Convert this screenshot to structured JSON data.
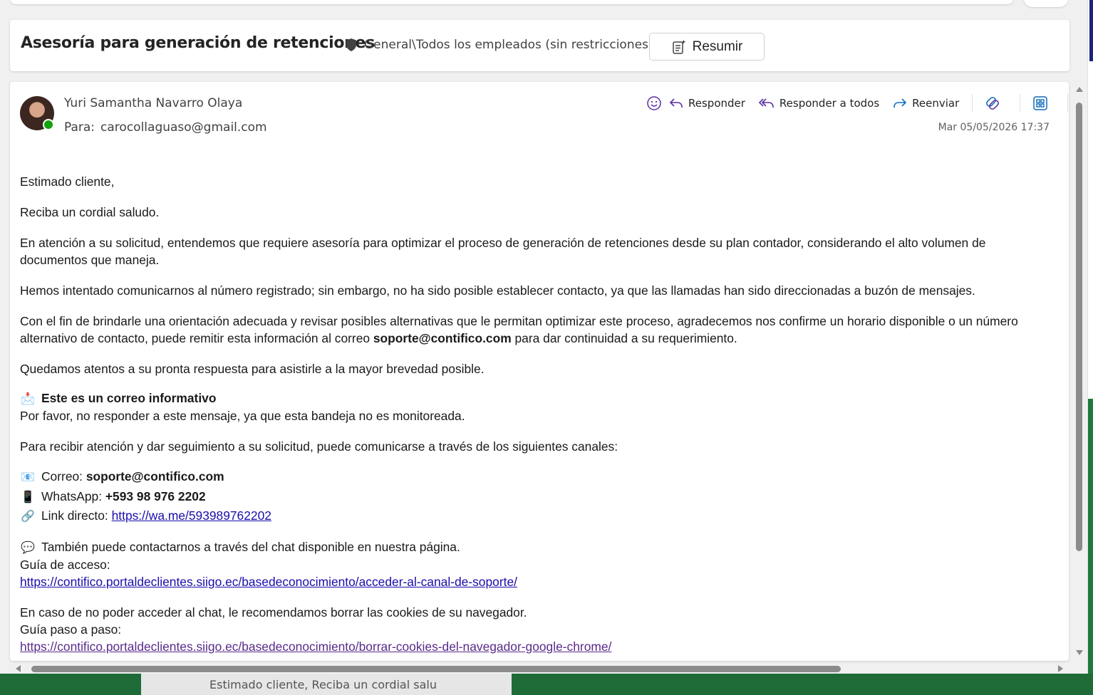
{
  "subject": {
    "title": "Asesoría para generación de retenciones",
    "sensitivity": "General\\Todos los empleados (sin restricciones)",
    "summarize_label": "Resumir"
  },
  "message": {
    "sender": "Yuri Samantha Navarro Olaya",
    "to_label": "Para:",
    "to": "carocollaguaso@gmail.com",
    "date": "Mar 05/05/2026 17:37",
    "actions": {
      "reply": "Responder",
      "reply_all": "Responder a todos",
      "forward": "Reenviar"
    }
  },
  "body": {
    "greeting": "Estimado cliente,",
    "salute": "Reciba un cordial saludo.",
    "p1": "En atención a su solicitud, entendemos que requiere asesoría para optimizar el proceso de generación de retenciones desde su plan contador, considerando el alto volumen de documentos que maneja.",
    "p2": "Hemos intentado comunicarnos al número registrado; sin embargo, no ha sido posible establecer contacto, ya que las llamadas han sido direccionadas a buzón de mensajes.",
    "p3_a": "Con el fin de brindarle una orientación adecuada y revisar posibles alternativas que le permitan optimizar este proceso, agradecemos nos confirme un horario disponible o un número alternativo de contacto, puede remitir esta información al correo ",
    "p3_email": "soporte@contifico.com",
    "p3_b": " para dar continuidad a su requerimiento.",
    "p4": "Quedamos atentos a su pronta respuesta para asistirle a la mayor brevedad posible.",
    "info_title": "Este es un correo informativo",
    "info_text": "Por favor, no responder a este mensaje, ya que esta bandeja no es monitoreada.",
    "channels_intro": "Para recibir atención y dar seguimiento a su solicitud, puede comunicarse a través de los siguientes canales:",
    "email_label": "Correo: ",
    "email_value": "soporte@contifico.com",
    "whatsapp_label": "WhatsApp: ",
    "whatsapp_value": "+593 98 976 2202",
    "link_label": "Link directo: ",
    "link_value": "https://wa.me/593989762202",
    "chat_text": "También puede contactarnos a través del chat disponible en nuestra página.",
    "guide_label": "Guía de acceso:",
    "guide_url": "https://contifico.portaldeclientes.siigo.ec/basedeconocimiento/acceder-al-canal-de-soporte/",
    "cookies_text": "En caso de no poder acceder al chat, le recomendamos borrar las cookies de su navegador.",
    "step_label": "Guía paso a paso:",
    "step_url": "https://contifico.portaldeclientes.siigo.ec/basedeconocimiento/borrar-cookies-del-navegador-google-chrome/"
  },
  "preview_text": "Estimado cliente, Reciba un cordial salu",
  "icons": {
    "emoji": "smiley-icon",
    "reply": "reply-icon",
    "reply_all": "reply-all-icon",
    "forward": "forward-icon",
    "loop": "loop-icon",
    "apps": "apps-icon",
    "more": "more-icon"
  },
  "colors": {
    "accent": "#5b2fa0",
    "link": "#1a0dab",
    "visited_link": "#5a2a8a",
    "presence": "#13a10e"
  }
}
